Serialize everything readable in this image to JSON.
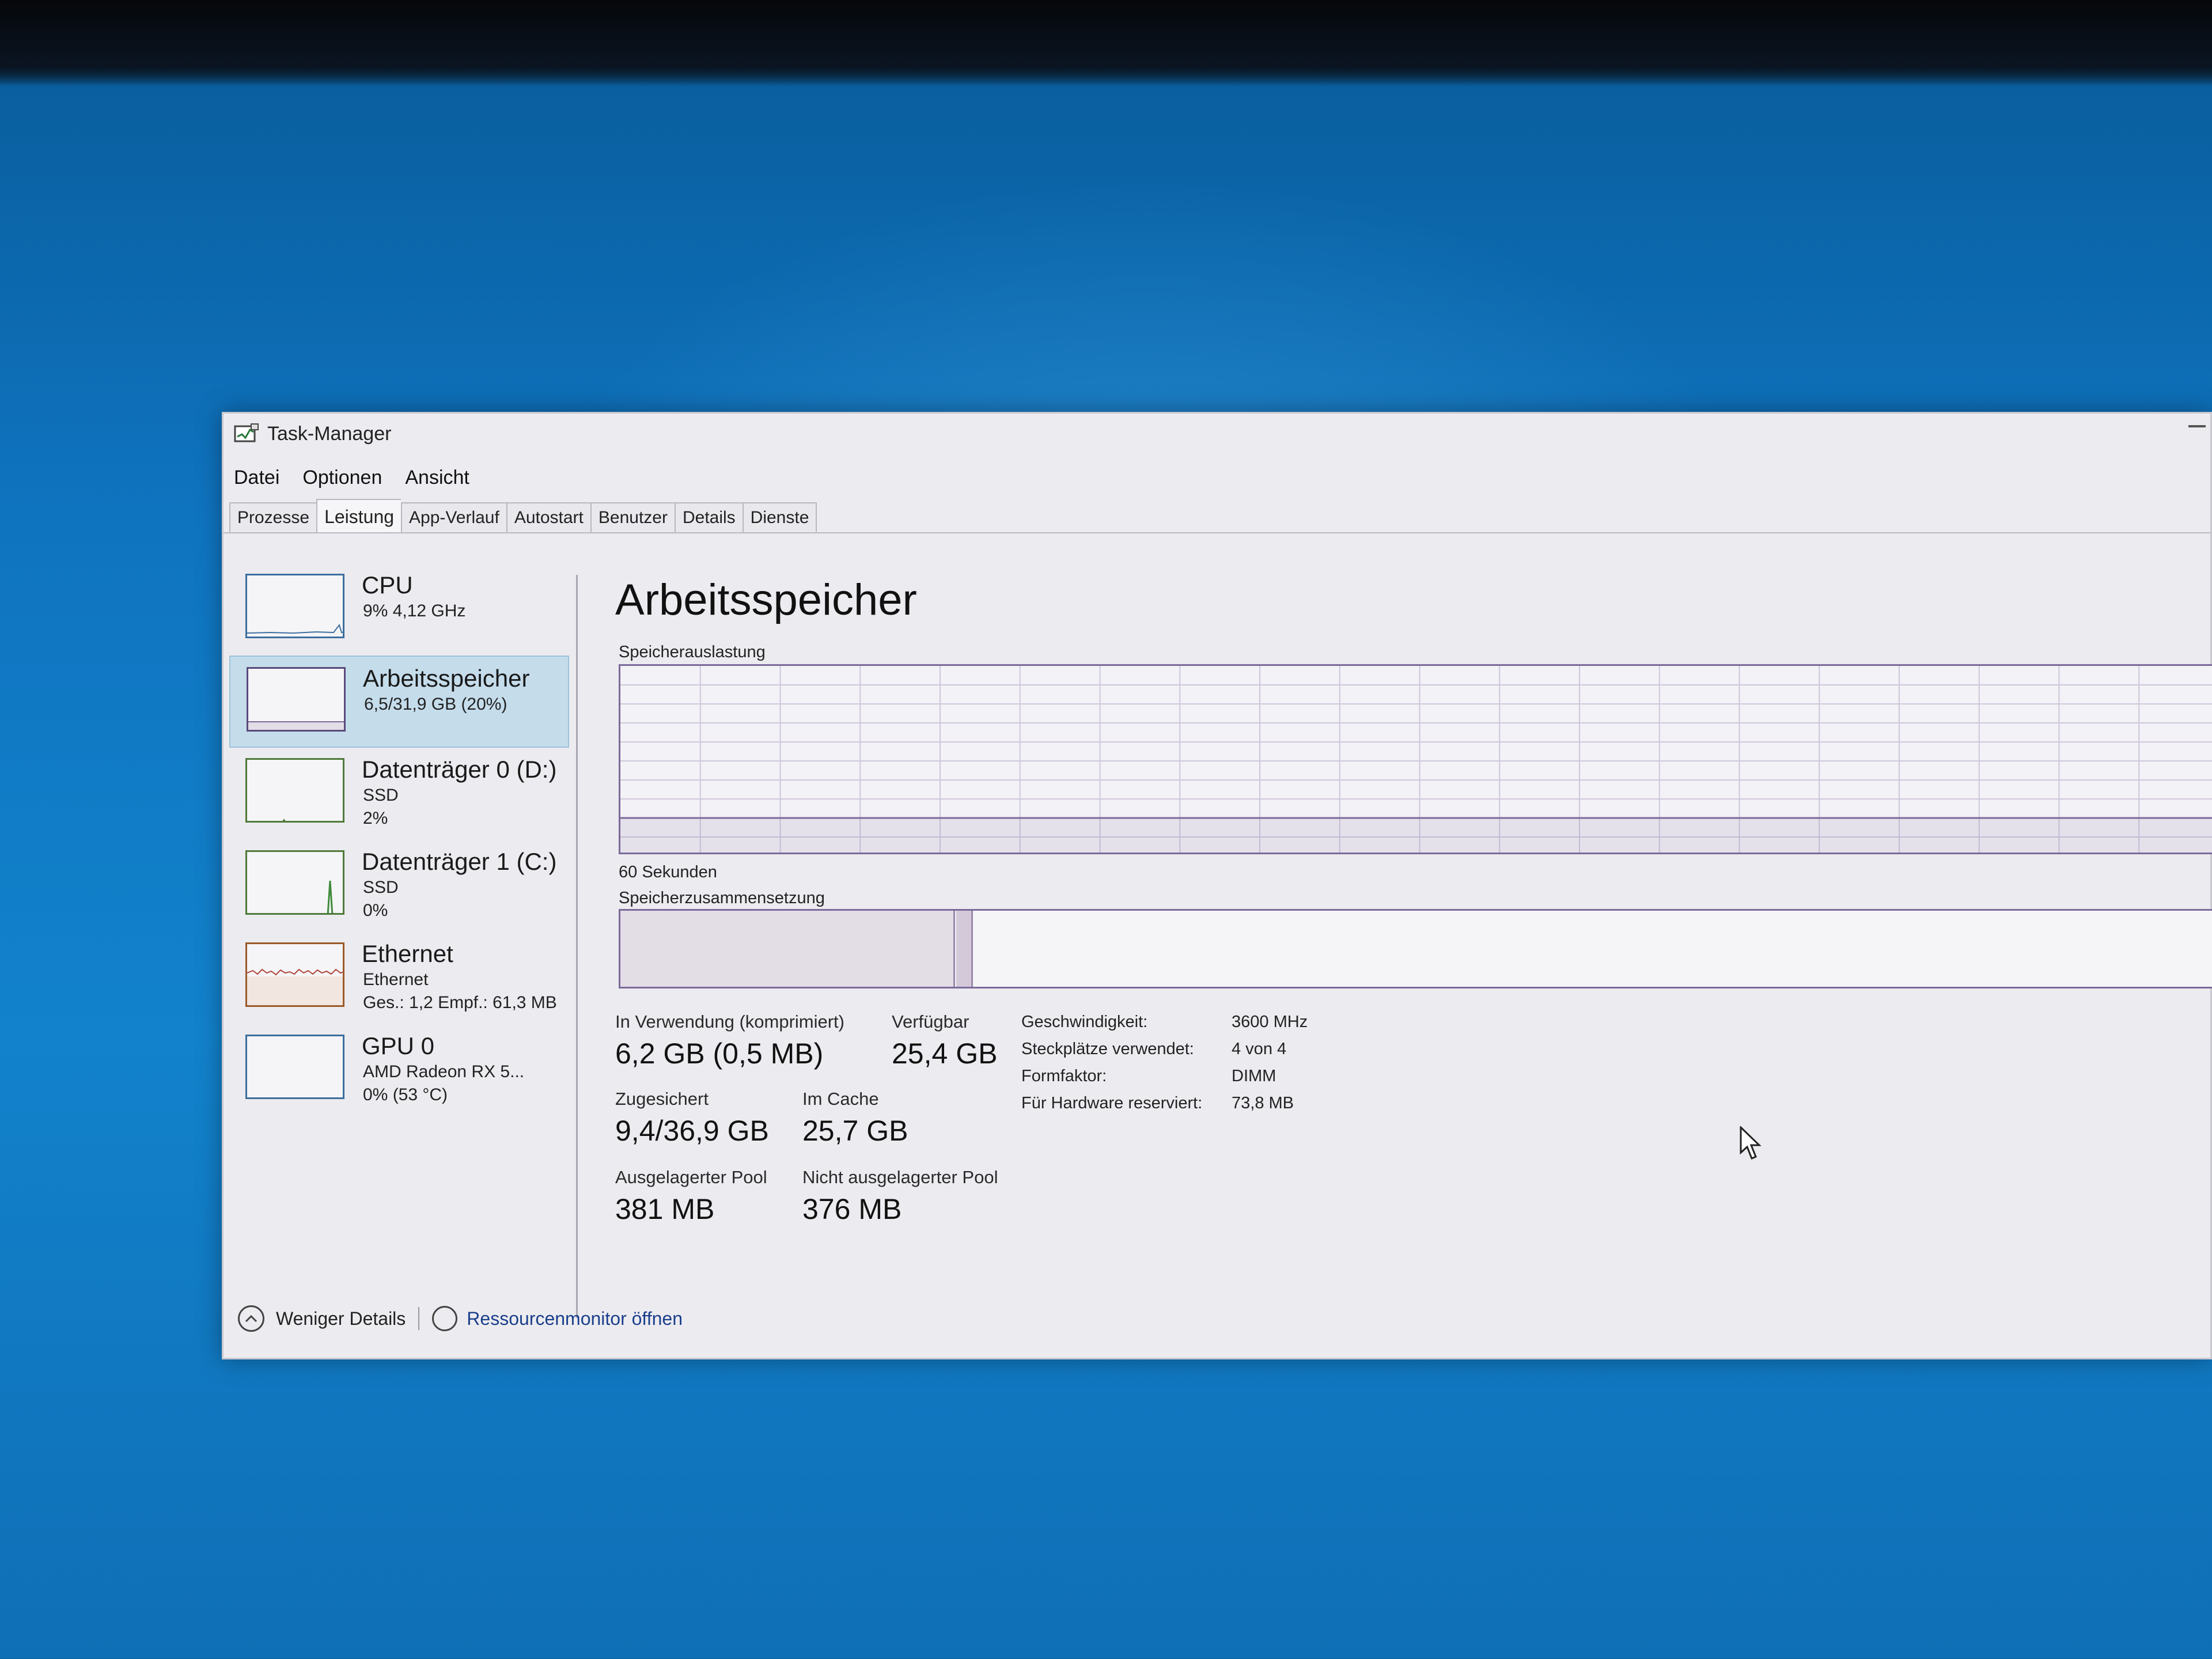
{
  "window": {
    "title": "Task-Manager"
  },
  "menu": [
    "Datei",
    "Optionen",
    "Ansicht"
  ],
  "tabs": [
    "Prozesse",
    "Leistung",
    "App-Verlauf",
    "Autostart",
    "Benutzer",
    "Details",
    "Dienste"
  ],
  "active_tab": "Leistung",
  "sidebar": {
    "items": [
      {
        "name": "CPU",
        "sub": "9% 4,12 GHz",
        "sub2": ""
      },
      {
        "name": "Arbeitsspeicher",
        "sub": "6,5/31,9 GB (20%)",
        "sub2": ""
      },
      {
        "name": "Datenträger 0 (D:)",
        "sub": "SSD",
        "sub2": "2%"
      },
      {
        "name": "Datenträger 1 (C:)",
        "sub": "SSD",
        "sub2": "0%"
      },
      {
        "name": "Ethernet",
        "sub": "Ethernet",
        "sub2": "Ges.: 1,2 Empf.: 61,3 MB"
      },
      {
        "name": "GPU 0",
        "sub": "AMD Radeon RX 5...",
        "sub2": "0% (53 °C)"
      }
    ]
  },
  "main": {
    "heading": "Arbeitsspeicher",
    "usage_label": "Speicherauslastung",
    "time_label": "60 Sekunden",
    "composition_label": "Speicherzusammensetzung",
    "stats": {
      "in_use_label": "In Verwendung (komprimiert)",
      "in_use_value": "6,2 GB (0,5 MB)",
      "available_label": "Verfügbar",
      "available_value": "25,4 GB",
      "committed_label": "Zugesichert",
      "committed_value": "9,4/36,9 GB",
      "cached_label": "Im Cache",
      "cached_value": "25,7 GB",
      "paged_label": "Ausgelagerter Pool",
      "paged_value": "381 MB",
      "nonpaged_label": "Nicht ausgelagerter Pool",
      "nonpaged_value": "376 MB"
    },
    "info": {
      "speed_label": "Geschwindigkeit:",
      "speed_value": "3600 MHz",
      "slots_label": "Steckplätze verwendet:",
      "slots_value": "4 von 4",
      "form_label": "Formfaktor:",
      "form_value": "DIMM",
      "reserved_label": "Für Hardware reserviert:",
      "reserved_value": "73,8 MB"
    }
  },
  "footer": {
    "less_details": "Weniger Details",
    "resource_monitor": "Ressourcenmonitor öffnen"
  },
  "colors": {
    "memory_accent": "#7b6a9a",
    "selected_item": "#c5dceb",
    "desktop_blue": "#0f74c0"
  }
}
